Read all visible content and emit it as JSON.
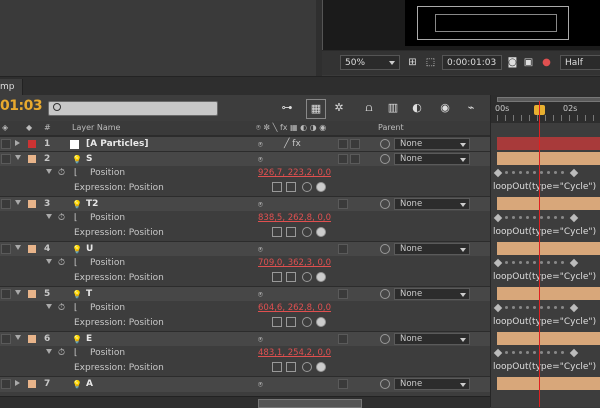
{
  "viewer": {
    "zoom": "50%",
    "timecode": "0:00:01:03",
    "resolution": "Half"
  },
  "timeline": {
    "tab_label": "mp",
    "current_time": "01:03",
    "search_placeholder": "",
    "headers": {
      "num": "#",
      "layer_name": "Layer Name",
      "parent": "Parent"
    },
    "ruler": {
      "label_0": "00s",
      "label_2": "02s"
    },
    "layers": [
      {
        "num": "1",
        "name": "[A Particles]",
        "label_color": "#cc3333",
        "parent": "None"
      },
      {
        "num": "2",
        "name": "S",
        "label_color": "#e8b48a",
        "parent": "",
        "position": "926,7, 223,2, 0,0",
        "expression_label": "Expression: Position",
        "expression": "loopOut(type=\"Cycle\")"
      },
      {
        "num": "3",
        "name": "T2",
        "label_color": "#e8b48a",
        "parent": "None",
        "position": "838,5, 262,8, 0,0",
        "expression_label": "Expression: Position",
        "expression": "loopOut(type=\"Cycle\")"
      },
      {
        "num": "4",
        "name": "U",
        "label_color": "#e8b48a",
        "parent": "None",
        "position": "709,0, 362,3, 0,0",
        "expression_label": "Expression: Position",
        "expression": "loopOut(type=\"Cycle\")"
      },
      {
        "num": "5",
        "name": "T",
        "label_color": "#e8b48a",
        "parent": "None",
        "position": "604,6, 262,8, 0,0",
        "expression_label": "Expression: Position",
        "expression": "loopOut(type=\"Cycle\")"
      },
      {
        "num": "6",
        "name": "E",
        "label_color": "#e8b48a",
        "parent": "None",
        "position": "483,1, 254,2, 0,0",
        "expression_label": "Expression: Position",
        "expression": "loopOut(type=\"Cycle\")"
      },
      {
        "num": "7",
        "name": "A",
        "label_color": "#e8b48a",
        "parent": "None"
      }
    ],
    "property_name": "Position",
    "parent_none": "None",
    "colors": {
      "accent": "#e8a92e",
      "playhead": "#e02020",
      "value": "#e05050",
      "bar_solid": "#a83a3a",
      "bar_layer": "#d8a77a"
    }
  }
}
